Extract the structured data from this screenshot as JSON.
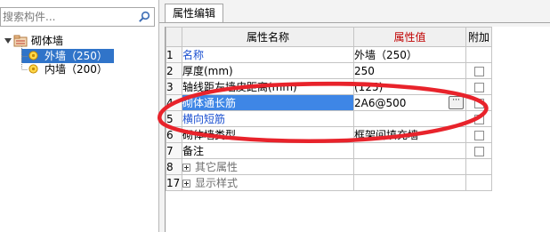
{
  "search": {
    "placeholder": "搜索构件..."
  },
  "icons": {
    "search": "search-icon",
    "folder": "component-folder-icon",
    "gear": "component-gear-icon"
  },
  "tree": {
    "root": {
      "label": "砌体墙"
    },
    "children": [
      {
        "label": "外墙（250）",
        "selected": true
      },
      {
        "label": "内墙（200）",
        "selected": false
      }
    ]
  },
  "tab": {
    "label": "属性编辑"
  },
  "grid": {
    "headers": {
      "index": "",
      "name": "属性名称",
      "value": "属性值",
      "attach": "附加"
    },
    "rows": [
      {
        "index": "1",
        "name": "名称",
        "value": "外墙（250）"
      },
      {
        "index": "2",
        "name": "厚度(mm)",
        "value": "250"
      },
      {
        "index": "3",
        "name": "轴线距左墙皮距离(mm)",
        "value": "(125)"
      },
      {
        "index": "4",
        "name": "砌体通长筋",
        "value": "2A6@500"
      },
      {
        "index": "5",
        "name": "横向短筋",
        "value": ""
      },
      {
        "index": "6",
        "name": "砌体墙类型",
        "value": "框架间填充墙"
      },
      {
        "index": "7",
        "name": "备注",
        "value": ""
      },
      {
        "index": "8",
        "name": "其它属性",
        "value": ""
      },
      {
        "index": "17",
        "name": "显示样式",
        "value": ""
      }
    ],
    "ellipsis_label": "···"
  },
  "colors": {
    "value_header_bg": "#f7c863",
    "value_header_text": "#c00000",
    "selection": "#3074c9",
    "active_row": "#3e86e6",
    "annotation": "#e8232b"
  }
}
